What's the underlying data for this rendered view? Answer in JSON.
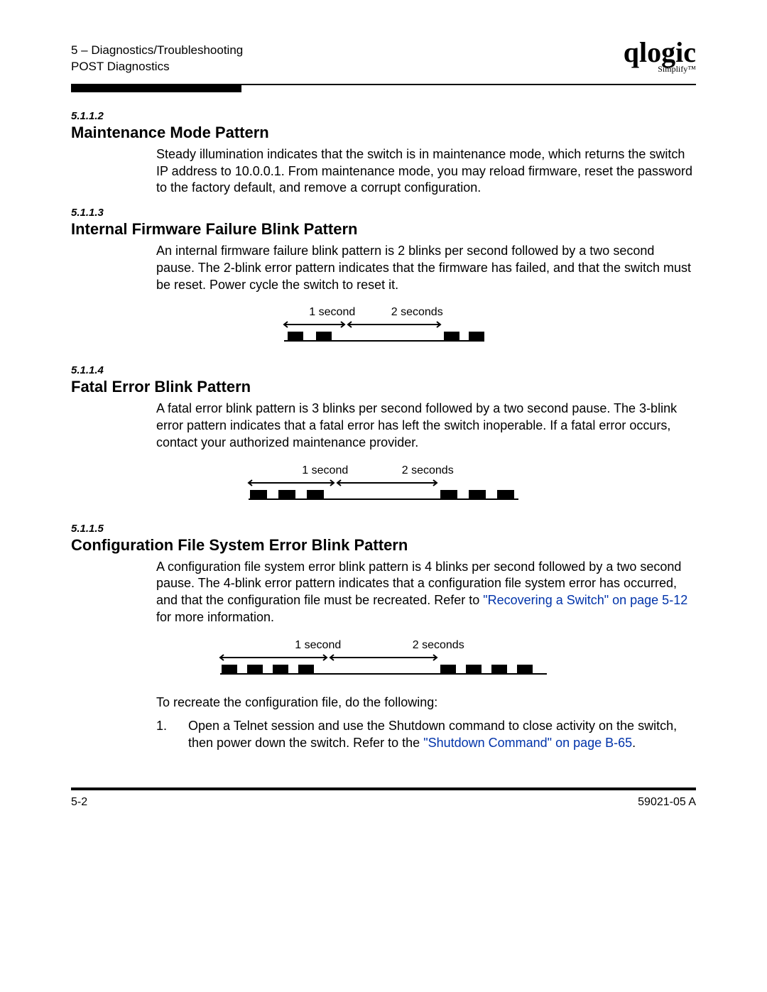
{
  "header": {
    "chapter_line": "5 – Diagnostics/Troubleshooting",
    "section_line": "POST Diagnostics",
    "logo_script": "qlogic",
    "logo_sub": "Simplify™"
  },
  "sections": {
    "s1": {
      "num": "5.1.1.2",
      "title": "Maintenance Mode Pattern",
      "body": "Steady illumination indicates that the switch is in maintenance mode, which returns the switch IP address to 10.0.0.1. From maintenance mode, you may reload firmware, reset the password to the factory default, and remove a corrupt configuration."
    },
    "s2": {
      "num": "5.1.1.3",
      "title": "Internal Firmware Failure Blink Pattern",
      "body": "An internal firmware failure blink pattern is 2 blinks per second followed by a two second pause. The 2-blink error pattern indicates that the firmware has failed, and that the switch must be reset. Power cycle the switch to reset it.",
      "diag": {
        "l1": "1 second",
        "l2": "2 seconds",
        "blinks": 2
      }
    },
    "s3": {
      "num": "5.1.1.4",
      "title": "Fatal Error Blink Pattern",
      "body": "A fatal error blink pattern is 3 blinks per second followed by a two second pause. The 3-blink error pattern indicates that a fatal error has left the switch inoperable. If a fatal error occurs, contact your authorized maintenance provider.",
      "diag": {
        "l1": "1 second",
        "l2": "2 seconds",
        "blinks": 3
      }
    },
    "s4": {
      "num": "5.1.1.5",
      "title": "Configuration File System Error Blink Pattern",
      "body_pre": "A configuration file system error blink pattern is 4 blinks per second followed by a two second pause. The 4-blink error pattern indicates that a configuration file system error has occurred, and that the configuration file must be recreated. Refer to ",
      "link1": "\"Recovering a Switch\" on page 5-12",
      "body_post": " for more information.",
      "diag": {
        "l1": "1 second",
        "l2": "2 seconds",
        "blinks": 4
      },
      "after_diag": "To recreate the configuration file, do the following:",
      "step1_num": "1.",
      "step1_pre": "Open a Telnet session and use the Shutdown command to close activity on the switch, then power down the switch. Refer to the ",
      "step1_link": "\"Shutdown Command\" on page B-65",
      "step1_post": "."
    }
  },
  "footer": {
    "left": "5-2",
    "right": "59021-05  A"
  }
}
